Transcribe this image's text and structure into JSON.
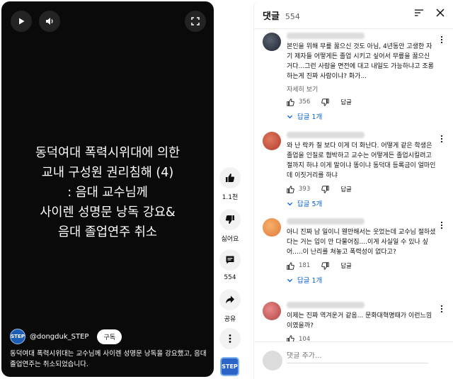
{
  "player": {
    "overlay_lines": [
      "동덕여대 폭력시위대에 의한",
      "교내 구성원 권리침해 (4)",
      ": 음대 교수님께",
      "사이렌 성명문 낭독 강요&",
      "음대 졸업연주 취소"
    ],
    "channel_name": "@dongduk_STEP",
    "channel_avatar_text": "STEP",
    "subscribe_label": "구독",
    "description": "동덕여대 폭력시위대는 교수님께 사이렌 성명문 낭독을 강요했고, 음대 졸업연주는 취소되었습니다."
  },
  "actions": {
    "like_count": "1.1천",
    "dislike_label": "싫어요",
    "comment_count": "554",
    "share_label": "공유"
  },
  "comments_panel": {
    "title": "댓글",
    "count": "554",
    "reply_label": "답글",
    "add_placeholder": "댓글 추가...",
    "comments": [
      {
        "text": "본인을 위해 무릎 꿇으신 것도 아님, 4년동안 고생한 자기 제자들 어떻게든 졸업 시키고 싶어서 무릎을 꿇으신 거다...그런 사람을 면전에 대고 내일도 가능하냐고 조롱하는게 진짜 사람이냐? 화가...",
        "more": "자세히 보기",
        "likes": "356",
        "replies": "답글 1개"
      },
      {
        "text": "와 난 락카 칠 보다 이게 더 화난다. 어떻게 같은 학생은 졸업을 인질로 협박하고 교수는 어떻게든 졸업시킬려고 절까지 하냐 이게 말이냐 똥이냐 동덕대 등록금이 얼마인데 이짓거리를 하냐",
        "likes": "393",
        "replies": "답글 5개"
      },
      {
        "text": "아니 진짜 남 일이니 웬만해서는 웃었는데 교수님 절하셨다는 거는 입이 안 다물어짐....이게 사실일 수 있나 싶어.....이 난리를 쳐놓고 폭력성이 없다고?",
        "likes": "181",
        "replies": "답글 1개"
      },
      {
        "text": "이제는 진짜 역겨운거 같음... 문화대혁명때가 이런느낌이였을까?",
        "likes": "104"
      }
    ]
  }
}
